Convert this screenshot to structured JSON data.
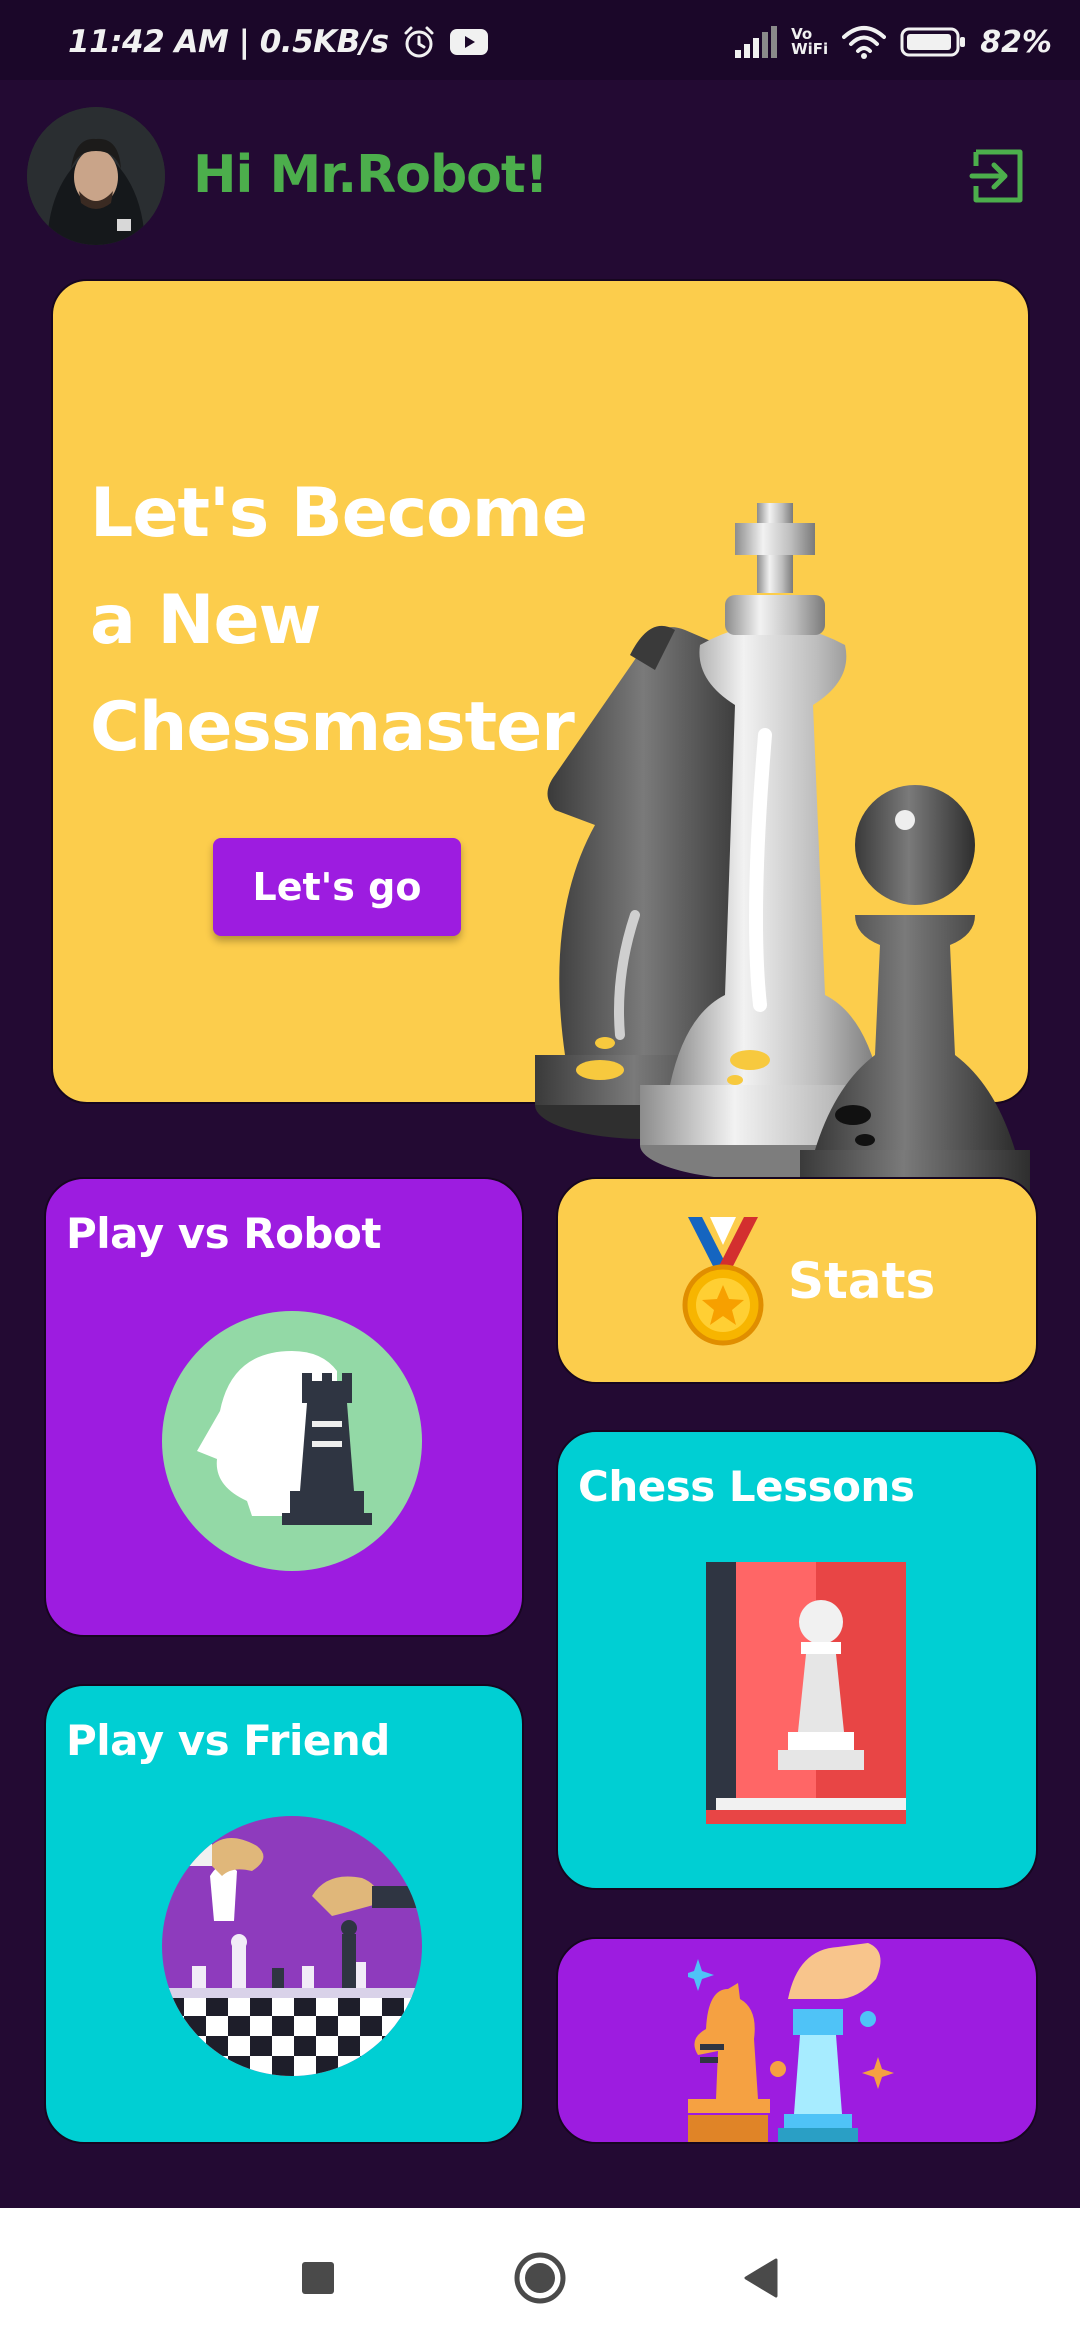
{
  "status_bar": {
    "time_speed": "11:42 AM | 0.5KB/s",
    "vowifi_top": "Vo",
    "vowifi_bottom": "WiFi",
    "battery": "82%"
  },
  "header": {
    "greeting": "Hi Mr.Robot!",
    "logout_icon": "logout-icon",
    "green": "#4cae4c"
  },
  "hero": {
    "title_line1": "Let's Become",
    "title_line2": "a New",
    "title_line3": "Chessmaster",
    "button_label": "Let's go",
    "background": "#fccd4c"
  },
  "cards": {
    "robot": {
      "title": "Play vs Robot"
    },
    "stats": {
      "title": "Stats",
      "icon": "medal-icon"
    },
    "lessons": {
      "title": "Chess Lessons",
      "icon": "book-pawn-icon"
    },
    "friend": {
      "title": "Play vs Friend"
    },
    "extra": {
      "icon": "chess-knight-hand-icon"
    }
  },
  "colors": {
    "purple": "#9d1ce0",
    "yellow": "#fccd4c",
    "cyan": "#00cfd3",
    "page_bg": "#230a33"
  },
  "nav": {
    "recent_icon": "square-icon",
    "home_icon": "circle-icon",
    "back_icon": "triangle-back-icon"
  }
}
